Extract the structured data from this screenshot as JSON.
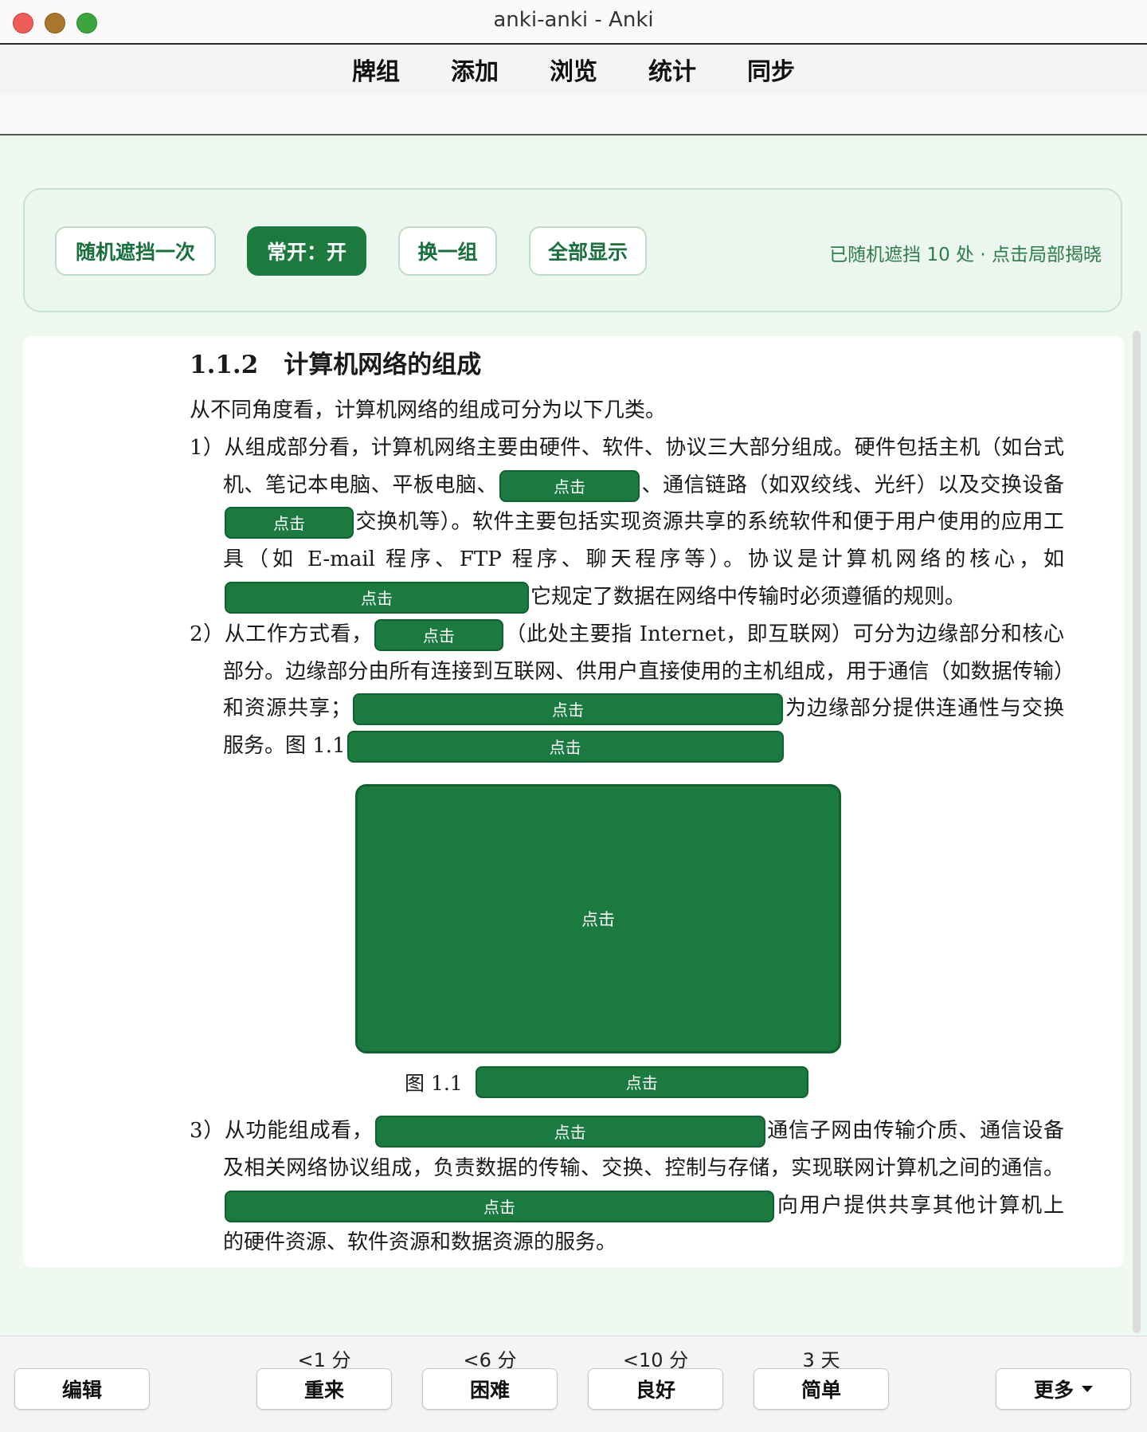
{
  "window": {
    "title": "anki-anki - Anki"
  },
  "menu": [
    "牌组",
    "添加",
    "浏览",
    "统计",
    "同步"
  ],
  "toolbar": {
    "random_mask": "随机遮挡一次",
    "always_on": "常开：开",
    "switch_group": "换一组",
    "show_all": "全部显示",
    "status": "已随机遮挡 10 处 · 点击局部揭晓"
  },
  "occlusion_label": "点击",
  "document": {
    "heading_num": "1.1.2",
    "heading_title": "计算机网络的组成",
    "intro": "从不同角度看，计算机网络的组成可分为以下几类。",
    "item1": {
      "t1": "1）从组成部分看，计算机网络主要由硬件、软件、协议三大部分组成。硬件包括主机（如台式机、笔记本电脑、平板电脑、",
      "t2": "、通信链路（如双绞线、光纤）以及交换设备",
      "t3": "交换机等）。软件主要包括实现资源共享的系统软件和便于用户使用的应用工具（如 E-mail 程序、FTP 程序、聊天程序等）。协议是计算机网络的核心，如",
      "t4": "它规定了数据在网络中传输时必须遵循的规则。"
    },
    "item2": {
      "t1": "2）从工作方式看，",
      "t2": "（此处主要指 Internet，即互联网）可分为边缘部分和核心部分。边缘部分由所有连接到互联网、供用户直接使用的主机组成，用于通信（如数据传输）和资源共享；",
      "t3": "为边缘部分提供连通性与交换服务。图 1.1"
    },
    "caption_prefix": "图 1.1",
    "item3": {
      "t1": "3）从功能组成看，",
      "t2": "通信子网由传输介质、通信设备及相关网络协议组成，负责数据的传输、交换、控制与存储，实现联网计算机之间的通信。",
      "t3": "向用户提供共享其他计算机上的硬件资源、软件资源和数据资源的服务。"
    }
  },
  "answer_buttons": [
    {
      "interval": "<1 分",
      "label": "重来"
    },
    {
      "interval": "<6 分",
      "label": "困难"
    },
    {
      "interval": "<10 分",
      "label": "良好"
    },
    {
      "interval": "3 天",
      "label": "简单"
    }
  ],
  "edit_label": "编辑",
  "more_label": "更多"
}
